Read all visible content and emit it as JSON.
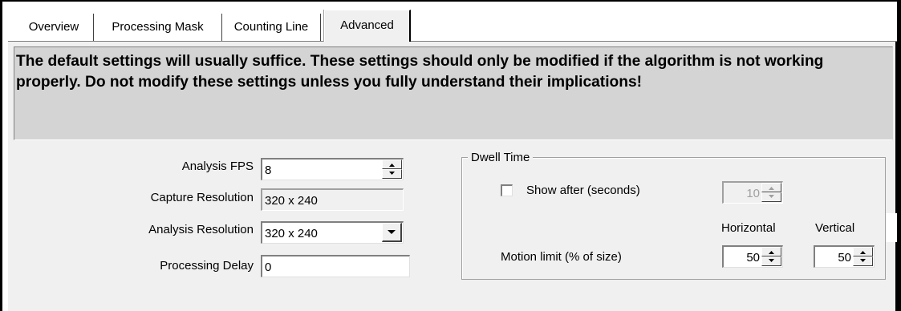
{
  "tabs": [
    {
      "label": "Overview",
      "active": false
    },
    {
      "label": "Processing Mask",
      "active": false
    },
    {
      "label": "Counting Line",
      "active": false
    },
    {
      "label": "Advanced",
      "active": true
    }
  ],
  "warning": "The default settings will usually suffice. These settings should only be modified if the algorithm is not working properly. Do not modify these settings unless you fully understand their implications!",
  "form": {
    "analysis_fps": {
      "label": "Analysis FPS",
      "value": "8"
    },
    "capture_resolution": {
      "label": "Capture Resolution",
      "value": "320 x 240"
    },
    "analysis_resolution": {
      "label": "Analysis Resolution",
      "value": "320 x 240"
    },
    "processing_delay": {
      "label": "Processing Delay",
      "value": "0"
    }
  },
  "dwell_time": {
    "title": "Dwell Time",
    "show_after": {
      "label": "Show after (seconds)",
      "checked": false,
      "value": "10",
      "enabled": false
    },
    "motion_limit": {
      "label": "Motion limit (% of size)",
      "horizontal_label": "Horizontal",
      "vertical_label": "Vertical",
      "horizontal_value": "50",
      "vertical_value": "50"
    }
  },
  "icons": {
    "spin_up": "spin-up-arrow-icon",
    "spin_down": "spin-down-arrow-icon",
    "dropdown": "chevron-down-icon"
  }
}
